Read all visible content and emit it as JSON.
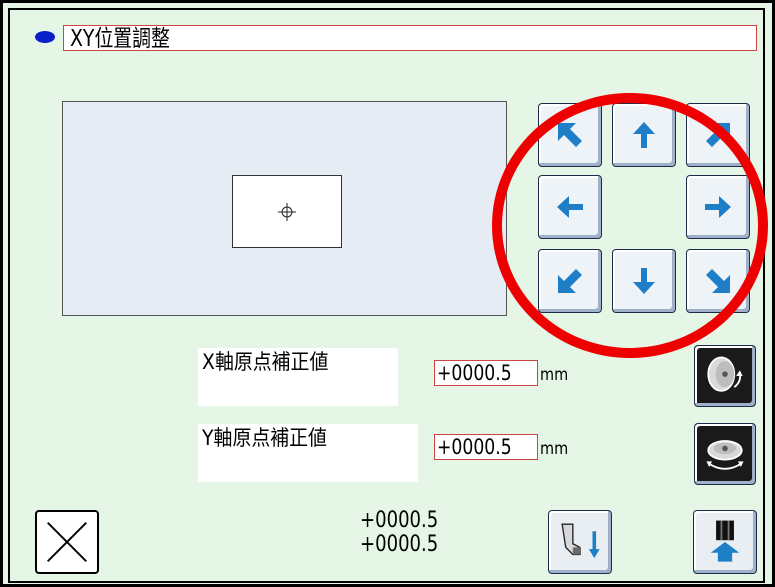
{
  "header": {
    "title": "XY位置調整"
  },
  "x_axis": {
    "label": "X軸原点補正値",
    "value": "+0000.5",
    "unit": "mm"
  },
  "y_axis": {
    "label": "Y軸原点補正値",
    "value": "+0000.5",
    "unit": "mm"
  },
  "position_readout": {
    "x": "+0000.5",
    "y": "+0000.5"
  },
  "icons": {
    "close": "close-x-icon",
    "x_dial": "x-dial-icon",
    "y_dial": "y-dial-icon",
    "move_down": "presser-move-down-icon",
    "confirm": "needle-up-icon"
  },
  "colors": {
    "background": "#e6f6e6",
    "accent_blue": "#1e7fc8",
    "highlight_ring": "#ee0000"
  }
}
